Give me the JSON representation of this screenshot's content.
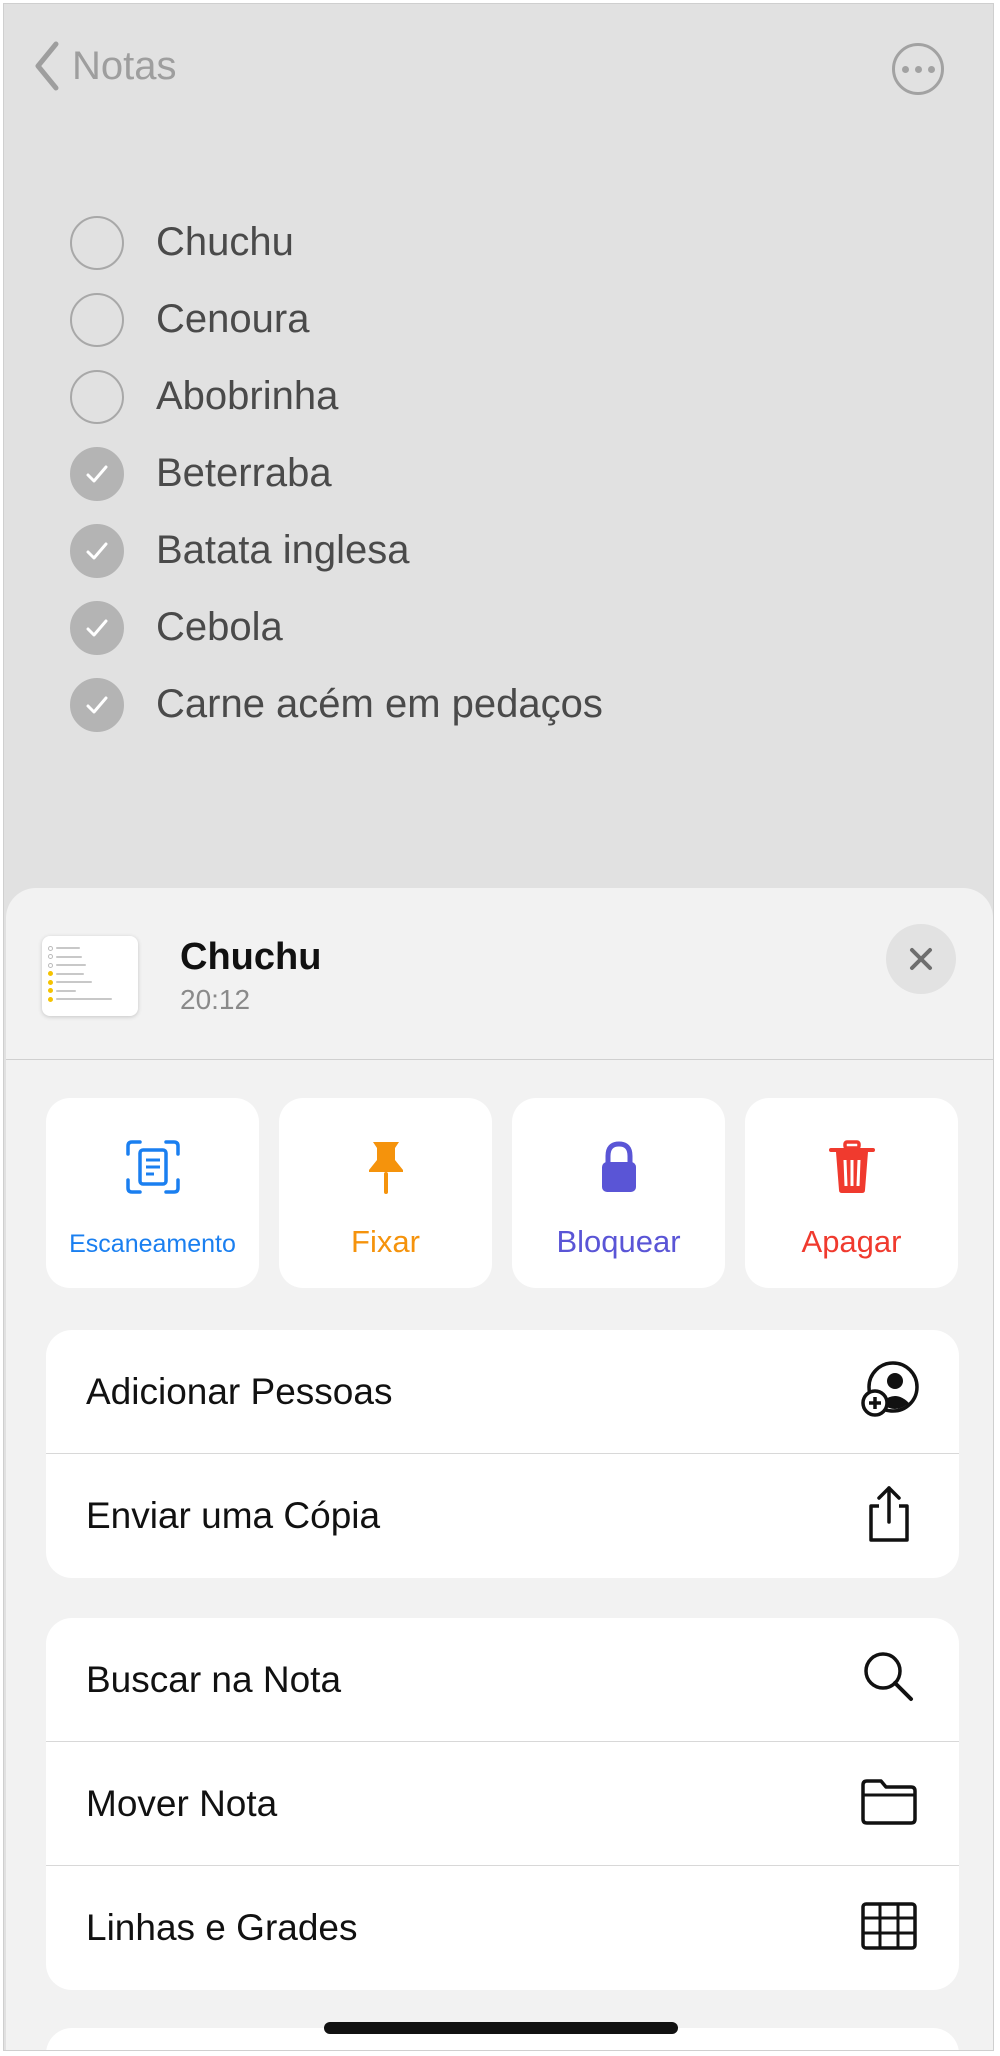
{
  "nav": {
    "back_label": "Notas",
    "back_icon": "chevron-left-icon",
    "more_icon": "ellipsis-circle-icon"
  },
  "checklist": [
    {
      "text": "Chuchu",
      "checked": false
    },
    {
      "text": "Cenoura",
      "checked": false
    },
    {
      "text": "Abobrinha",
      "checked": false
    },
    {
      "text": "Beterraba",
      "checked": true
    },
    {
      "text": "Batata inglesa",
      "checked": true
    },
    {
      "text": "Cebola",
      "checked": true
    },
    {
      "text": "Carne acém em pedaços",
      "checked": true
    }
  ],
  "sheet": {
    "title": "Chuchu",
    "time": "20:12",
    "close_icon": "close-icon"
  },
  "actions": [
    {
      "label": "Escaneamento",
      "icon": "scan-document-icon",
      "color": "#1a7ff0"
    },
    {
      "label": "Fixar",
      "icon": "pin-icon",
      "color": "#f5930c"
    },
    {
      "label": "Bloquear",
      "icon": "lock-icon",
      "color": "#5a55d6"
    },
    {
      "label": "Apagar",
      "icon": "trash-icon",
      "color": "#f03a2e"
    }
  ],
  "group1": [
    {
      "label": "Adicionar Pessoas",
      "icon": "add-person-icon"
    },
    {
      "label": "Enviar uma Cópia",
      "icon": "share-icon"
    }
  ],
  "group2": [
    {
      "label": "Buscar na Nota",
      "icon": "search-icon"
    },
    {
      "label": "Mover Nota",
      "icon": "folder-icon"
    },
    {
      "label": "Linhas e Grades",
      "icon": "grid-icon"
    }
  ]
}
